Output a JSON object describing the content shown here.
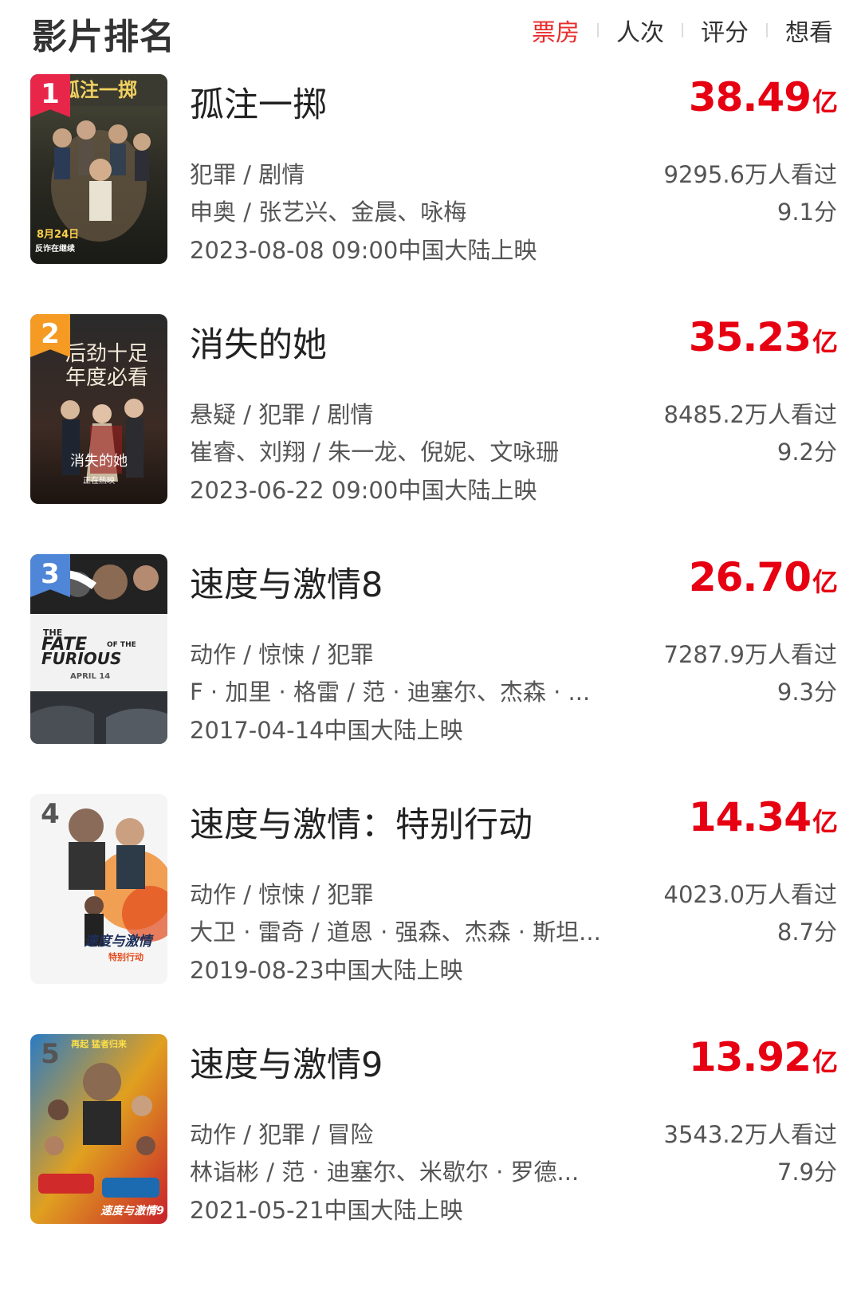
{
  "header": {
    "title": "影片排名",
    "tabs": [
      "票房",
      "人次",
      "评分",
      "想看"
    ],
    "active_tab": "票房"
  },
  "colors": {
    "accent": "#e82c2c",
    "boxoffice": "#e60012",
    "rank1": "#e8264a",
    "rank2": "#f59a23",
    "rank3": "#4f86d8"
  },
  "movies": [
    {
      "rank": "1",
      "title": "孤注一掷",
      "boxoffice": "38.49",
      "unit": "亿",
      "genre": "犯罪 / 剧情",
      "cast": "申奥 / 张艺兴、金晨、咏梅",
      "release": "2023-08-08 09:00中国大陆上映",
      "viewers": "9295.6万人看过",
      "score": "9.1分",
      "poster_text": "孤注一掷",
      "poster_date": "8月24日",
      "poster_sub": "反诈在继续"
    },
    {
      "rank": "2",
      "title": "消失的她",
      "boxoffice": "35.23",
      "unit": "亿",
      "genre": "悬疑 / 犯罪 / 剧情",
      "cast": "崔睿、刘翔 / 朱一龙、倪妮、文咏珊",
      "release": "2023-06-22 09:00中国大陆上映",
      "viewers": "8485.2万人看过",
      "score": "9.2分",
      "poster_line1": "后劲十足",
      "poster_line2": "年度必看",
      "poster_text": "消失的她",
      "poster_sub": "正在热映"
    },
    {
      "rank": "3",
      "title": "速度与激情8",
      "boxoffice": "26.70",
      "unit": "亿",
      "genre": "动作 / 惊悚 / 犯罪",
      "cast": "F · 加里 · 格雷 / 范 · 迪塞尔、杰森 · ...",
      "release": "2017-04-14中国大陆上映",
      "viewers": "7287.9万人看过",
      "score": "9.3分",
      "poster_text1": "THE",
      "poster_text2": "FATE",
      "poster_text3": "OF THE",
      "poster_text4": "FURIOUS",
      "poster_date": "APRIL 14"
    },
    {
      "rank": "4",
      "title": "速度与激情：特别行动",
      "boxoffice": "14.34",
      "unit": "亿",
      "genre": "动作 / 惊悚 / 犯罪",
      "cast": "大卫 · 雷奇 / 道恩 · 强森、杰森 · 斯坦...",
      "release": "2019-08-23中国大陆上映",
      "viewers": "4023.0万人看过",
      "score": "8.7分",
      "poster_text": "速度与激情",
      "poster_sub": "特别行动"
    },
    {
      "rank": "5",
      "title": "速度与激情9",
      "boxoffice": "13.92",
      "unit": "亿",
      "genre": "动作 / 犯罪 / 冒险",
      "cast": "林诣彬 / 范 · 迪塞尔、米歇尔 · 罗德...",
      "release": "2021-05-21中国大陆上映",
      "viewers": "3543.2万人看过",
      "score": "7.9分",
      "poster_top": "再起 猛者归来",
      "poster_text": "速度与激情9"
    }
  ]
}
